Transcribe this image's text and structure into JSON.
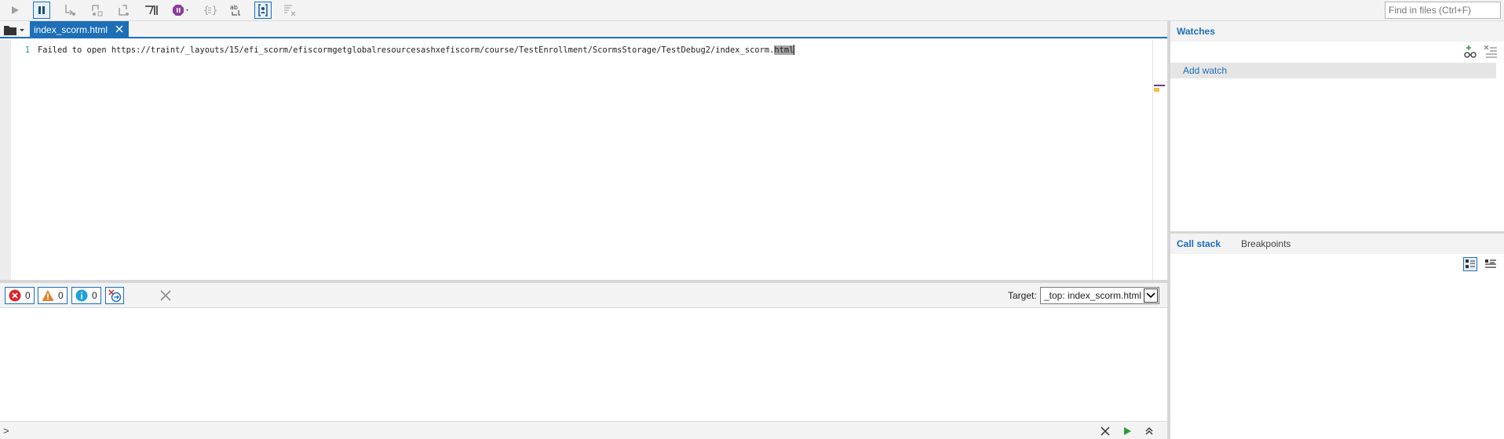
{
  "toolbar": {
    "buttons": [
      {
        "name": "continue-icon"
      },
      {
        "name": "pause-icon"
      },
      {
        "name": "step-into-icon"
      },
      {
        "name": "step-over-icon"
      },
      {
        "name": "step-out-icon"
      },
      {
        "name": "break-on-new-worker-icon"
      },
      {
        "name": "exception-behavior-icon"
      },
      {
        "name": "pretty-print-icon"
      },
      {
        "name": "word-wrap-icon"
      },
      {
        "name": "just-my-code-icon"
      },
      {
        "name": "clear-breakpoints-icon"
      }
    ],
    "find_placeholder": "Find in files (Ctrl+F)"
  },
  "editor": {
    "tab_label": "index_scorm.html",
    "line_number": "1",
    "line_text": "Failed to open https://traint/_layouts/15/efi_scorm/efiscormgetglobalresourcesashxefiscorm/course/TestEnrollment/ScormsStorage/TestDebug2/index_scorm.",
    "line_selected": "html"
  },
  "console": {
    "errors_count": "0",
    "warnings_count": "0",
    "info_count": "0",
    "target_label": "Target:",
    "target_value": "_top: index_scorm.html",
    "prompt": ">"
  },
  "watches": {
    "title": "Watches",
    "add_watch": "Add watch"
  },
  "callstack": {
    "tabs": [
      "Call stack",
      "Breakpoints"
    ]
  },
  "colors": {
    "accent": "#1d6fb8",
    "error": "#d9262b",
    "warning": "#e0822a",
    "info": "#1ea1d9",
    "run": "#2a9a3c"
  }
}
